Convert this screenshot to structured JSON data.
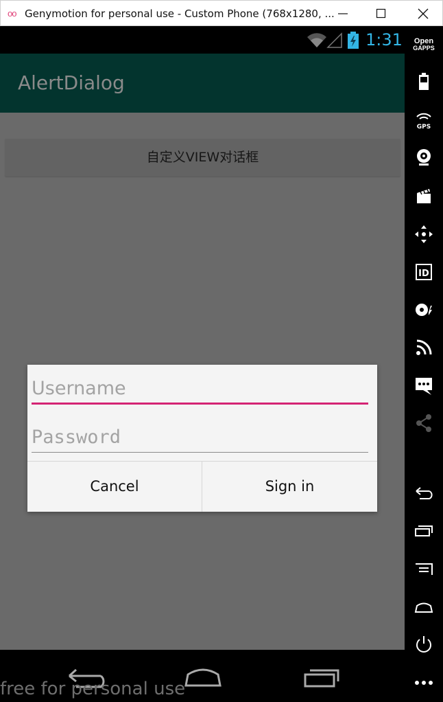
{
  "window": {
    "title": "Genymotion for personal use - Custom Phone (768x1280, ...",
    "logo": "oo"
  },
  "status": {
    "time": "1:31"
  },
  "app": {
    "title": "AlertDialog",
    "custom_view_button": "自定义VIEW对话框"
  },
  "dialog": {
    "username_placeholder": "Username",
    "password_placeholder": "Password",
    "cancel_label": "Cancel",
    "signin_label": "Sign in"
  },
  "navbar": {
    "watermark": "free for personal use"
  },
  "toolbar": {
    "opengapps_line1": "Open",
    "opengapps_line2": "GAPPS",
    "gps_label": "GPS",
    "id_label": "ID"
  },
  "colors": {
    "actionbar": "#03342e",
    "accent": "#d42474",
    "clock": "#33b5e5"
  }
}
